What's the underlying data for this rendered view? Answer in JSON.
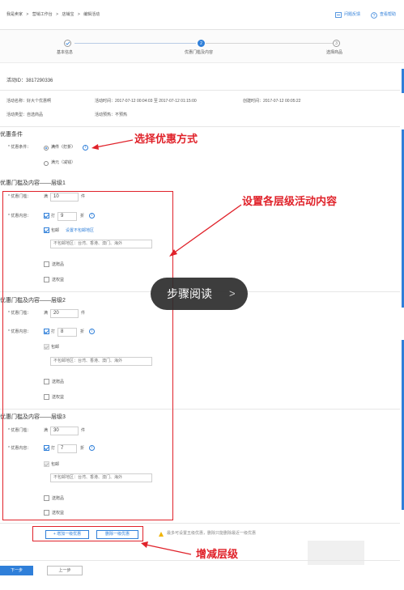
{
  "breadcrumb": [
    "我是卖家",
    "营销工作台",
    "店铺宝",
    "编辑活动"
  ],
  "breadcrumb_sep": ">",
  "header_links": {
    "feedback": "问题反馈",
    "help": "查看帮助"
  },
  "steps": [
    {
      "num": "1",
      "label": "基本信息"
    },
    {
      "num": "2",
      "label": "优惠门槛及内容"
    },
    {
      "num": "3",
      "label": "选择商品"
    }
  ],
  "activity": {
    "id_text": "活动ID：3817290336",
    "name_text": "活动名称：好大个优惠啊",
    "time_text": "活动时间：2017-07-12 00:04:03 至 2017-07-12 01:15:00",
    "created_text": "创建时间：2017-07-12 00:05:22",
    "type_text": "活动类型：自选商品",
    "preheat_text": "活动预热：不预热"
  },
  "condition": {
    "section_title": "优惠条件",
    "label": "* 优惠条件：",
    "options": [
      "满件（打折）",
      "满元（减钱）"
    ]
  },
  "tiers": [
    {
      "title": "优惠门槛及内容——层级1",
      "threshold_label": "* 优惠门槛：",
      "prefix": "满",
      "qty": "10",
      "qty_unit": "件",
      "content_label": "* 优惠内容：",
      "discount_check": "打",
      "discount": "9",
      "discount_unit": "折",
      "shipping": "包邮",
      "shipping_link": "设置不包邮地区",
      "excluded": "不包邮地区：台湾、香港、澳门、海外",
      "gift": "送赠品",
      "coupon": "送权益"
    },
    {
      "title": "优惠门槛及内容——层级2",
      "threshold_label": "* 优惠门槛：",
      "prefix": "满",
      "qty": "20",
      "qty_unit": "件",
      "content_label": "* 优惠内容：",
      "discount_check": "打",
      "discount": "8",
      "discount_unit": "折",
      "shipping": "包邮",
      "excluded": "不包邮地区：台湾、香港、澳门、海外",
      "gift": "送赠品",
      "coupon": "送权益"
    },
    {
      "title": "优惠门槛及内容——层级3",
      "threshold_label": "* 优惠门槛：",
      "prefix": "满",
      "qty": "30",
      "qty_unit": "件",
      "content_label": "* 优惠内容：",
      "discount_check": "打",
      "discount": "7",
      "discount_unit": "折",
      "shipping": "包邮",
      "excluded": "不包邮地区：台湾、香港、澳门、海外",
      "gift": "送赠品",
      "coupon": "送权益"
    }
  ],
  "tier_buttons": {
    "add": "+ 增加一级优惠",
    "remove": "删除一级优惠"
  },
  "tier_hint": "最多可设置五级优惠，删除只能删除最近一级优惠",
  "footer": {
    "next": "下一步",
    "prev": "上一步"
  },
  "annotations": {
    "choose": "选择优惠方式",
    "set_levels": "设置各层级活动内容",
    "adjust": "增减层级"
  },
  "overlay": {
    "label": "步骤阅读",
    "chevron": ">"
  },
  "colors": {
    "primary": "#2f7fd9",
    "annotation_red": "#e0222a",
    "overlay_bg": "#2d2d2d"
  }
}
